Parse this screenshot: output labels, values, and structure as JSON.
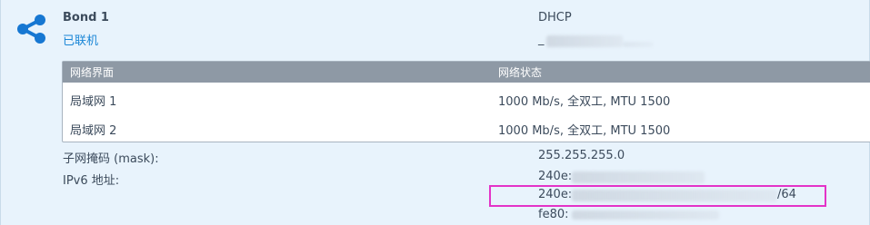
{
  "bond": {
    "name": "Bond 1",
    "status": "已联机",
    "ip_mode": "DHCP",
    "ip_prefix": "_"
  },
  "table": {
    "headers": [
      "网络界面",
      "网络状态"
    ],
    "rows": [
      {
        "iface": "局域网 1",
        "state": "1000 Mb/s, 全双工, MTU 1500"
      },
      {
        "iface": "局域网 2",
        "state": "1000 Mb/s, 全双工, MTU 1500"
      }
    ]
  },
  "details": {
    "mask_label": "子网掩码 (mask):",
    "mask_value": "255.255.255.0",
    "ipv6_label": "IPv6 地址:",
    "ipv6_1": "240e:",
    "ipv6_2_prefix": "240e:",
    "ipv6_2_suffix": "/64",
    "ipv6_3": "fe80:"
  },
  "icons": {
    "share": "share-icon"
  },
  "colors": {
    "link_blue": "#1a86d6",
    "icon_blue": "#1677d2",
    "header_gray": "#8e99a5",
    "highlight_magenta": "#e433c8"
  }
}
